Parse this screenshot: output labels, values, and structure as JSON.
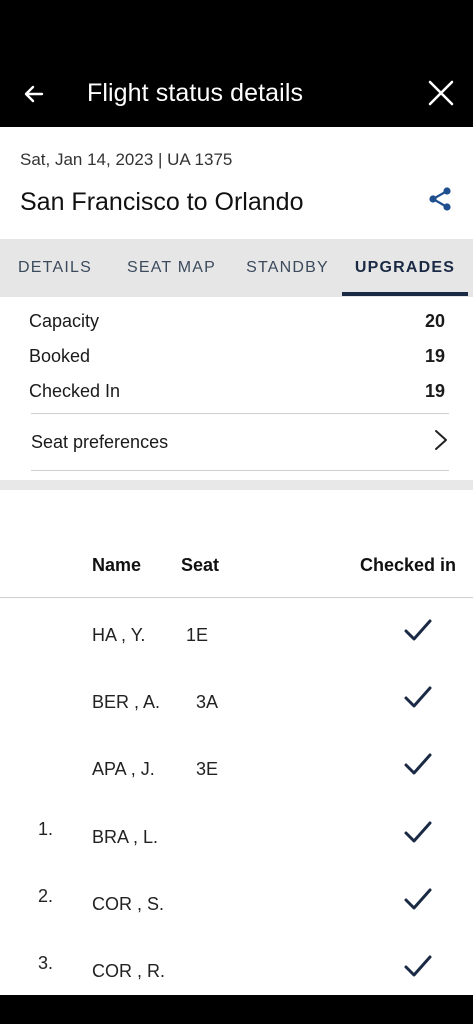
{
  "header": {
    "title": "Flight status details",
    "back_icon": "arrow-left-icon",
    "close_icon": "close-icon"
  },
  "flight": {
    "meta": "Sat, Jan 14, 2023 | UA 1375",
    "route": "San Francisco to Orlando",
    "share_icon": "share-icon"
  },
  "tabs": [
    {
      "label": "DETAILS",
      "active": false
    },
    {
      "label": "SEAT MAP",
      "active": false
    },
    {
      "label": "STANDBY",
      "active": false
    },
    {
      "label": "UPGRADES",
      "active": true
    }
  ],
  "stats": [
    {
      "label": "Capacity",
      "value": "20"
    },
    {
      "label": "Booked",
      "value": "19"
    },
    {
      "label": "Checked In",
      "value": "19"
    }
  ],
  "seat_preferences": {
    "label": "Seat preferences",
    "icon": "chevron-right-icon"
  },
  "table": {
    "headers": {
      "name": "Name",
      "seat": "Seat",
      "checked_in": "Checked in"
    },
    "rows": [
      {
        "num": "",
        "name": "HA , Y.",
        "seat": "1E",
        "checked_in": true
      },
      {
        "num": "",
        "name": "BER , A.",
        "seat": "3A",
        "checked_in": true
      },
      {
        "num": "",
        "name": "APA , J.",
        "seat": "3E",
        "checked_in": true
      },
      {
        "num": "1.",
        "name": "BRA , L.",
        "seat": "",
        "checked_in": true
      },
      {
        "num": "2.",
        "name": "COR , S.",
        "seat": "",
        "checked_in": true
      },
      {
        "num": "3.",
        "name": "COR , R.",
        "seat": "",
        "checked_in": true
      }
    ]
  },
  "colors": {
    "accent": "#1b2a44",
    "share_icon": "#1f4f8f",
    "tab_bar_bg": "#e6e6e6"
  }
}
